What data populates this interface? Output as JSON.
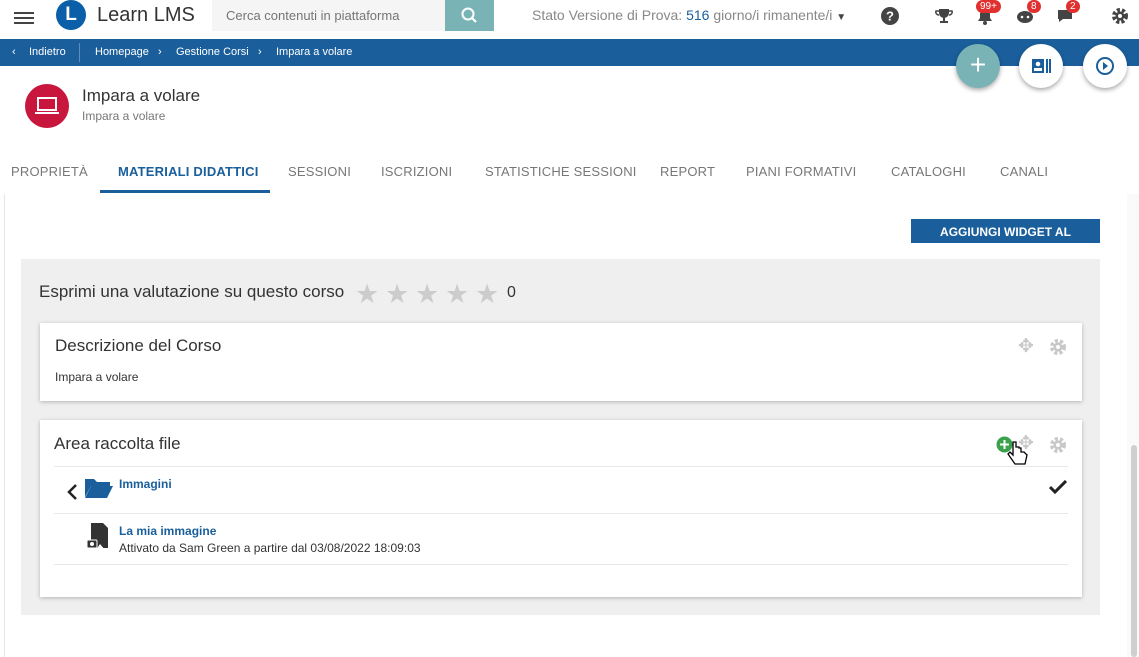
{
  "header": {
    "brand": "Learn LMS",
    "search_placeholder": "Cerca contenuti in piattaforma",
    "trial_prefix": "Stato Versione di Prova: ",
    "trial_days": "516",
    "trial_suffix": " giorno/i rimanente/i",
    "notifications_badge": "99+",
    "messages_badge": "8",
    "chat_badge": "2"
  },
  "breadcrumb": {
    "back": "Indietro",
    "items": [
      "Homepage",
      "Gestione Corsi",
      "Impara a volare"
    ]
  },
  "course": {
    "title": "Impara a volare",
    "subtitle": "Impara a volare"
  },
  "tabs": [
    "PROPRIETÀ",
    "MATERIALI DIDATTICI",
    "SESSIONI",
    "ISCRIZIONI",
    "STATISTICHE SESSIONI",
    "REPORT",
    "PIANI FORMATIVI",
    "CATALOGHI",
    "CANALI"
  ],
  "active_tab": "MATERIALI DIDATTICI",
  "toolbar": {
    "add_widget_label": "AGGIUNGI WIDGET AL CORSO"
  },
  "rating": {
    "label": "Esprimi una valutazione su questo corso",
    "value": "0",
    "stars_filled": 0,
    "stars_total": 5
  },
  "description_widget": {
    "title": "Descrizione del Corso",
    "body": "Impara a volare"
  },
  "files_widget": {
    "title": "Area raccolta file",
    "folder": {
      "name": "Immagini"
    },
    "file": {
      "name": "La mia immagine",
      "meta": "Attivato da Sam Green a partire dal 03/08/2022 18:09:03"
    }
  },
  "colors": {
    "primary": "#1a5f9c",
    "accent": "#7ab3b6",
    "course_icon": "#c8163d",
    "badge": "#e03030"
  }
}
